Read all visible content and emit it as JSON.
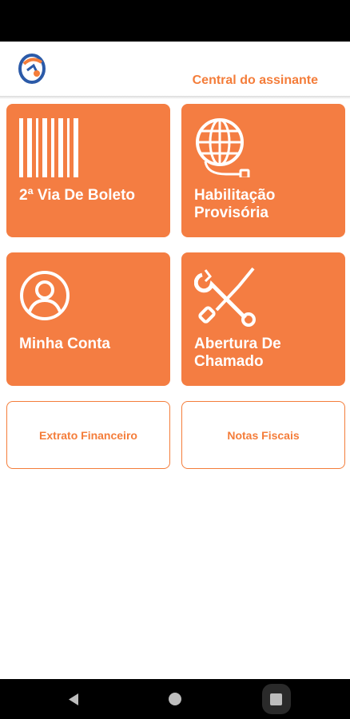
{
  "header": {
    "title": "Central do assinante"
  },
  "tiles": [
    {
      "label": "2ª Via De Boleto",
      "icon": "barcode-icon"
    },
    {
      "label": "Habilitação Provisória",
      "icon": "globe-cable-icon"
    },
    {
      "label": "Minha Conta",
      "icon": "user-icon"
    },
    {
      "label": "Abertura De Chamado",
      "icon": "wrench-screwdriver-icon"
    }
  ],
  "buttons": {
    "extrato": "Extrato Financeiro",
    "notas": "Notas Fiscais"
  },
  "colors": {
    "accent": "#f47d42",
    "text_accent": "#f47d3a"
  }
}
